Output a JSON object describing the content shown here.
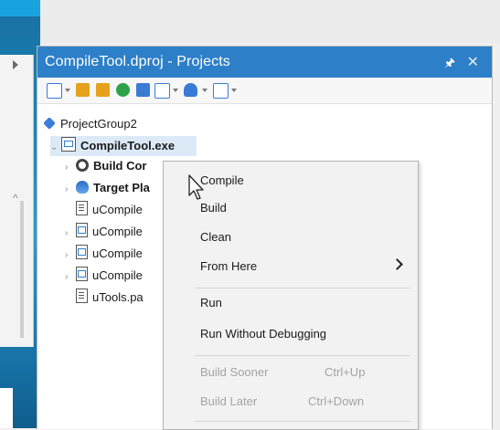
{
  "panel": {
    "title": "CompileTool.dproj - Projects",
    "pin_glyph": "🖈",
    "close_glyph": "✕"
  },
  "toolbar": {
    "buttons": [
      {
        "icon": "new-item-icon",
        "color": "#3a7bd5"
      },
      {
        "icon": "open-folder-icon",
        "color": "#e6a21c"
      },
      {
        "icon": "folder-icon",
        "color": "#e6a21c"
      },
      {
        "icon": "refresh-icon",
        "color": "#2ca34a"
      },
      {
        "icon": "build-icon",
        "color": "#3a7bd5"
      },
      {
        "icon": "run-icon",
        "color": "#3a7bd5"
      },
      {
        "icon": "layers-icon",
        "color": "#3a7bd5"
      },
      {
        "icon": "window-icon",
        "color": "#3a7bd5"
      }
    ]
  },
  "tree": {
    "items": [
      {
        "label": "ProjectGroup2"
      },
      {
        "label": "CompileTool.exe"
      },
      {
        "label": "Build Cor"
      },
      {
        "label": "Target Pla"
      },
      {
        "label": "uCompile"
      },
      {
        "label": "uCompile"
      },
      {
        "label": "uCompile"
      },
      {
        "label": "uCompile"
      },
      {
        "label": "uTools.pa"
      }
    ]
  },
  "context_menu": {
    "items": [
      {
        "label": "Compile"
      },
      {
        "label": "Build"
      },
      {
        "label": "Clean"
      },
      {
        "label": "From Here"
      },
      {
        "label": "Run"
      },
      {
        "label": "Run Without Debugging"
      },
      {
        "label": "Build Sooner",
        "shortcut": "Ctrl+Up"
      },
      {
        "label": "Build Later",
        "shortcut": "Ctrl+Down"
      }
    ]
  },
  "colors": {
    "titlebar": "#2d7fc8",
    "menu_bg": "#f2f2f2",
    "disabled_text": "#a3a3a3"
  }
}
